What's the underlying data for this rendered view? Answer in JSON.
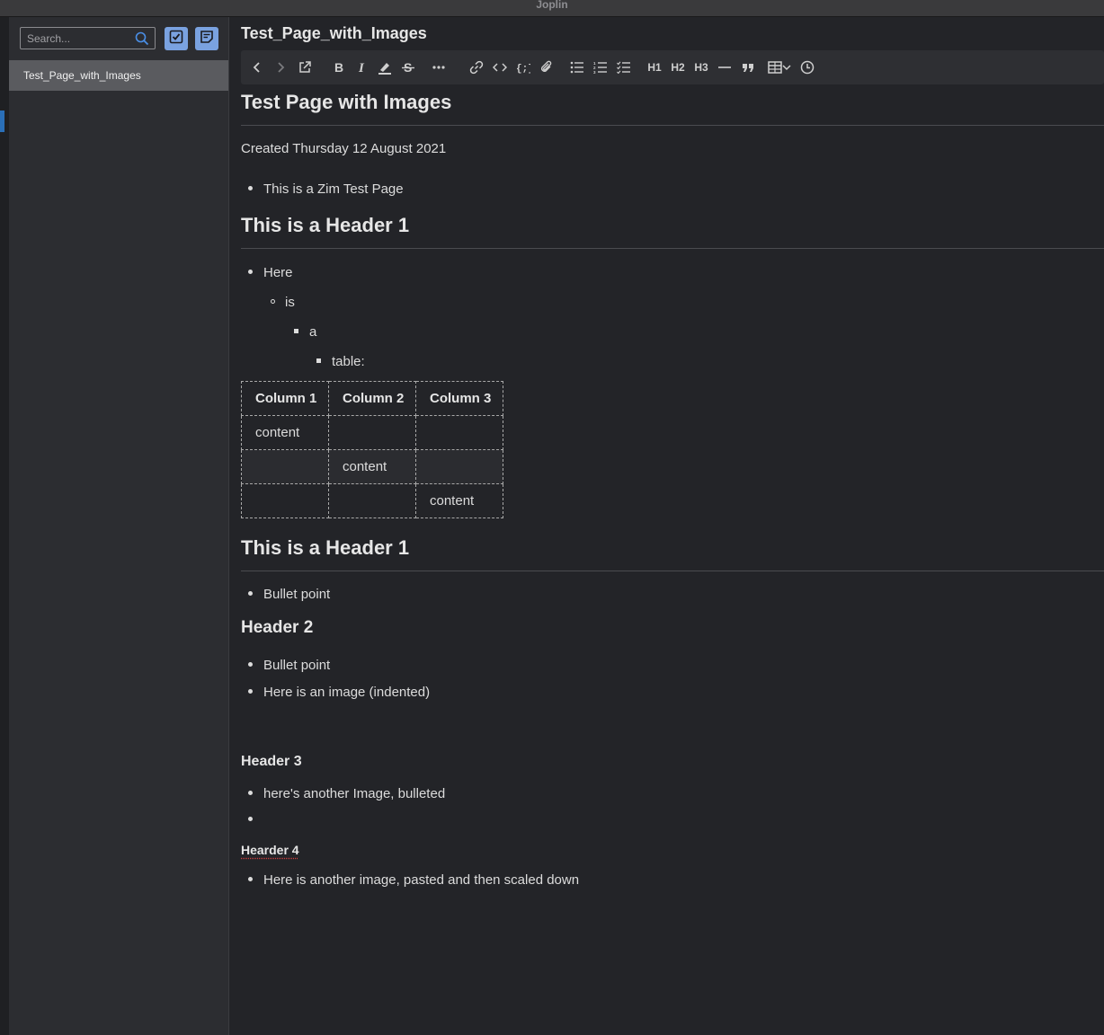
{
  "window": {
    "title": "Joplin"
  },
  "sidebar": {
    "search_placeholder": "Search...",
    "notes": [
      {
        "title": "Test_Page_with_Images"
      }
    ]
  },
  "editor": {
    "title": "Test_Page_with_Images",
    "toolbar": {
      "h1": "H1",
      "h2": "H2",
      "h3": "H3"
    }
  },
  "note": {
    "heading": "Test Page with Images",
    "created": "Created Thursday 12 August 2021",
    "intro_bullet": "This is a Zim Test Page",
    "section1_heading": "This is a Header 1",
    "nested_list": [
      "Here",
      "is",
      "a",
      "table:"
    ],
    "table": {
      "headers": [
        "Column 1",
        "Column 2",
        "Column 3"
      ],
      "rows": [
        [
          "content",
          "",
          ""
        ],
        [
          "",
          "content",
          ""
        ],
        [
          "",
          "",
          "content"
        ]
      ]
    },
    "section2_heading": "This is a Header 1",
    "section2_bullet": "Bullet point",
    "header2": "Header 2",
    "header2_bullets": [
      "Bullet point",
      "Here is an image (indented)"
    ],
    "header3": "Header 3",
    "header3_bullets": [
      "here's another Image, bulleted",
      ""
    ],
    "header4": "Hearder 4",
    "header4_bullet": "Here is another image, pasted and then scaled down"
  },
  "colors": {
    "accent": "#7aa2e0",
    "background": "#232428",
    "sidebar_bg": "#2c2d31",
    "selected_note": "#5a5b5f",
    "spellcheck": "#d04040"
  }
}
